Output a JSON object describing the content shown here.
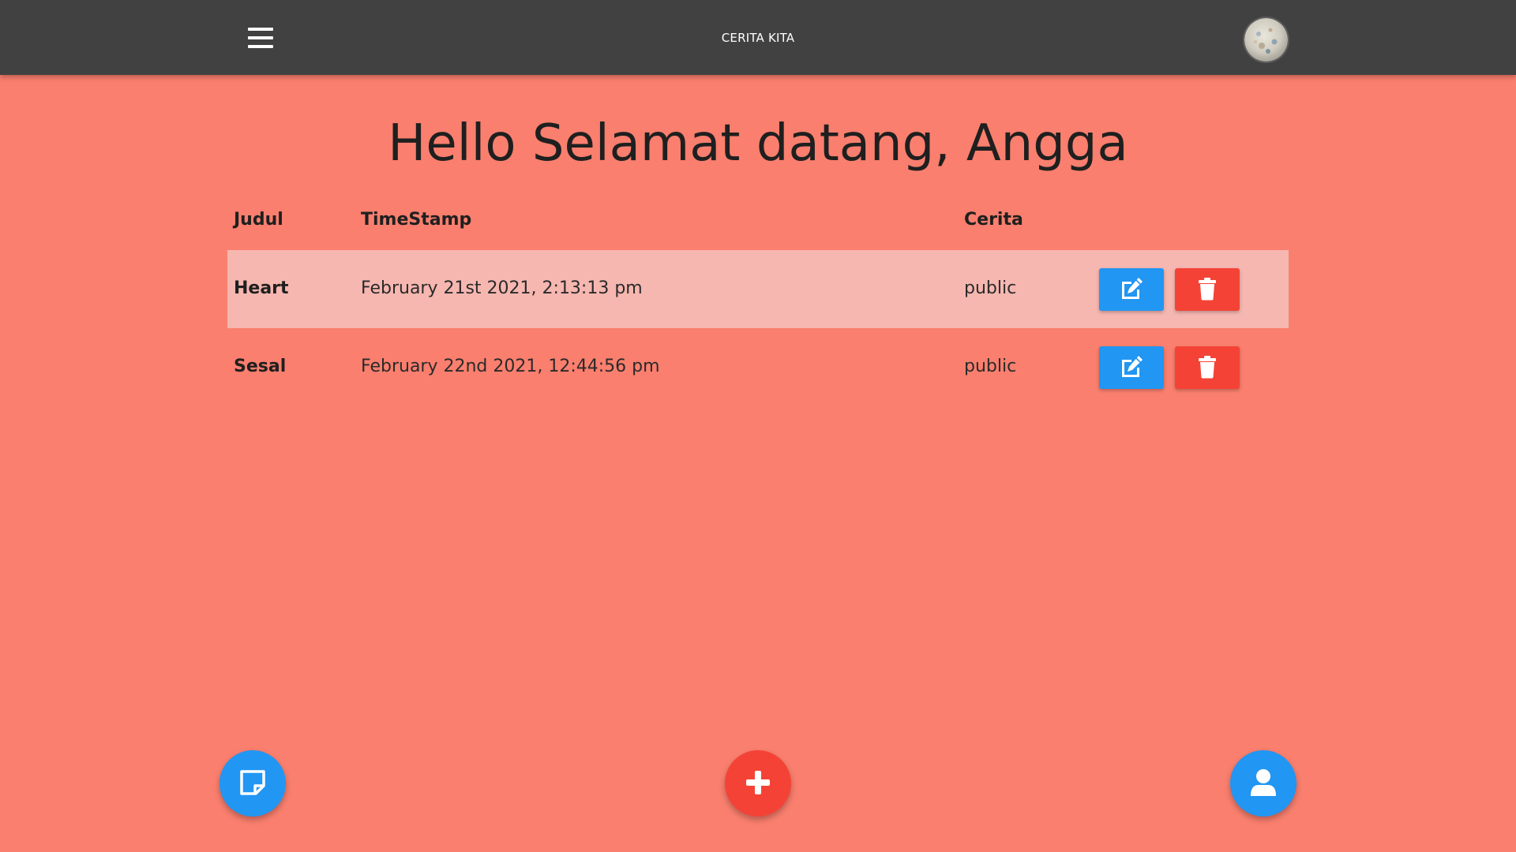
{
  "header": {
    "app_title": "CERITA KITA",
    "menu_icon": "hamburger-menu-icon",
    "avatar_icon": "user-avatar"
  },
  "main": {
    "greeting": "Hello Selamat datang, Angga"
  },
  "table": {
    "columns": [
      "Judul",
      "TimeStamp",
      "Cerita"
    ],
    "rows": [
      {
        "judul": "Heart",
        "timestamp": "February 21st 2021, 2:13:13 pm",
        "cerita": "public"
      },
      {
        "judul": "Sesal",
        "timestamp": "February 22nd 2021, 12:44:56 pm",
        "cerita": "public"
      }
    ],
    "edit_icon": "edit-icon",
    "delete_icon": "trash-icon"
  },
  "fabs": {
    "left_icon": "note-icon",
    "center_icon": "plus-icon",
    "right_icon": "user-icon"
  },
  "colors": {
    "background": "#fa7f6e",
    "topbar": "#414141",
    "row_highlight": "#f6b7b0",
    "primary_blue": "#2196f3",
    "danger_red": "#f44336"
  }
}
